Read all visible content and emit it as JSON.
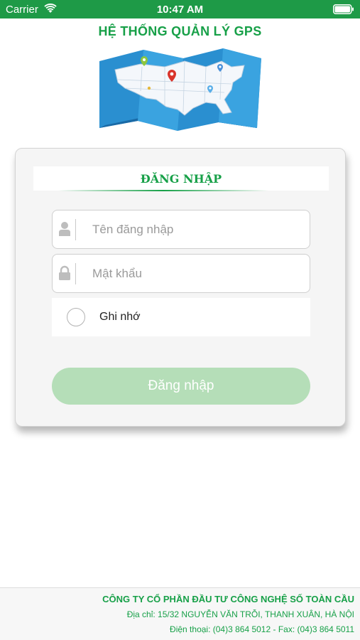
{
  "status_bar": {
    "carrier": "Carrier",
    "time": "10:47 AM",
    "icons": [
      "wifi-icon",
      "battery-icon"
    ]
  },
  "header": {
    "title": "HỆ THỐNG QUẢN LÝ GPS"
  },
  "login_card": {
    "title": "ĐĂNG NHẬP",
    "username": {
      "value": "",
      "placeholder": "Tên đăng nhập",
      "icon": "user-icon"
    },
    "password": {
      "value": "",
      "placeholder": "Mật khẩu",
      "icon": "lock-icon"
    },
    "remember": {
      "label": "Ghi nhớ",
      "checked": false
    },
    "submit_label": "Đăng nhập"
  },
  "footer": {
    "company": "CÔNG TY CỔ PHẦN ĐẦU TƯ CÔNG NGHỆ SỐ TOÀN CẦU",
    "address": "Địa chỉ: 15/32 NGUYỄN VĂN TRỖI, THANH XUÂN, HÀ NỘI",
    "phone": "Điện thoại: (04)3 864 5012 - Fax: (04)3 864 5011"
  },
  "colors": {
    "brand_green": "#17a048",
    "status_bar": "#1e9a47",
    "button_disabled": "#b5deb8"
  }
}
